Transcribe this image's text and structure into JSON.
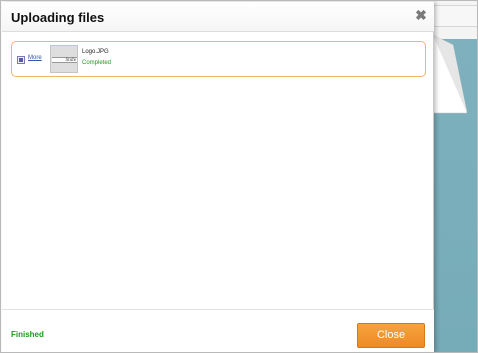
{
  "dialog": {
    "title": "Uploading files",
    "close_icon": "close-icon"
  },
  "files": [
    {
      "more_label": "More",
      "thumbnail_text": "Stufe",
      "name": "Logo.JPG",
      "status": "Completed",
      "checkbox_checked": true
    }
  ],
  "footer": {
    "status": "Finished",
    "close_label": "Close"
  },
  "colors": {
    "accent_button": "#ef8a23",
    "success_text": "#1a9a1a",
    "file_border": "#f2b46a",
    "background_teal": "#7eb1bd"
  }
}
